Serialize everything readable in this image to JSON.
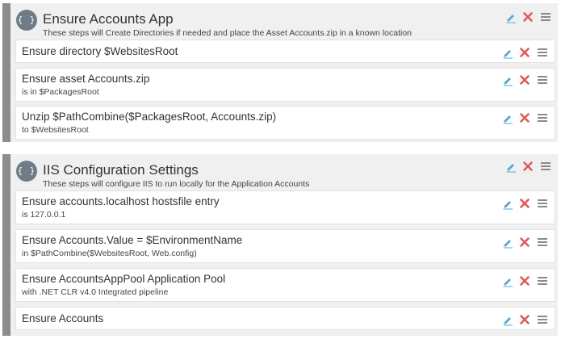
{
  "groups": [
    {
      "icon": "{ }",
      "title": "Ensure Accounts App",
      "description": "These steps will Create Directories if needed and place the Asset Accounts.zip in a known location",
      "steps": [
        {
          "title": "Ensure directory $WebsitesRoot",
          "sub": ""
        },
        {
          "title": "Ensure asset Accounts.zip",
          "sub": "is in $PackagesRoot"
        },
        {
          "title": "Unzip $PathCombine($PackagesRoot, Accounts.zip)",
          "sub": "to $WebsitesRoot"
        }
      ]
    },
    {
      "icon": "{ }",
      "title": "IIS Configuration Settings",
      "description": "These steps will configure IIS to run locally for the Application Accounts",
      "steps": [
        {
          "title": "Ensure accounts.localhost hostsfile entry",
          "sub": "is 127.0.0.1"
        },
        {
          "title": "Ensure Accounts.Value = $EnvironmentName",
          "sub": "in $PathCombine($WebsitesRoot, Web.config)"
        },
        {
          "title": "Ensure AccountsAppPool Application Pool",
          "sub": "with .NET CLR v4.0 Integrated pipeline"
        },
        {
          "title": "Ensure Accounts",
          "sub": ""
        }
      ]
    }
  ],
  "icons": {
    "edit": "pencil-icon",
    "delete": "close-icon",
    "drag": "drag-handle-icon"
  },
  "colors": {
    "edit": "#5aa7d6",
    "delete": "#e05a5a",
    "drag": "#8a8a8a",
    "group_bar": "#8c8c8c",
    "brace_circle": "#6f7b86"
  }
}
